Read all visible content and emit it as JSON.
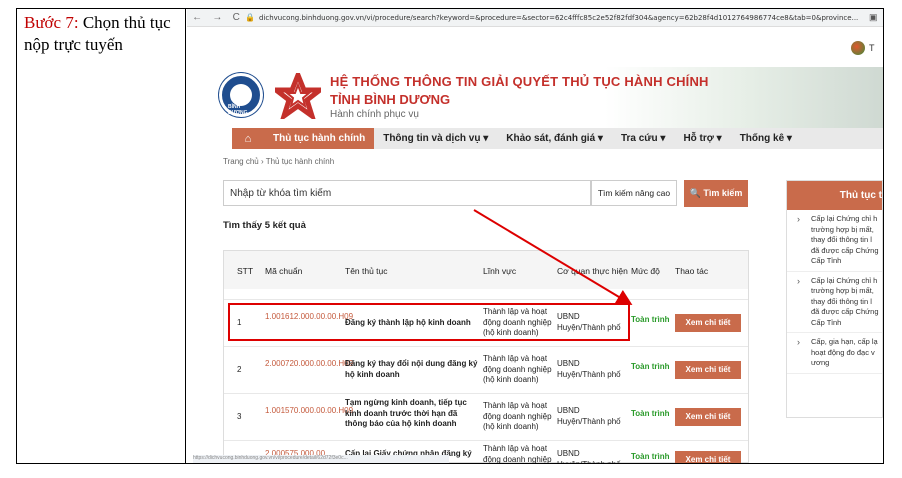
{
  "step": {
    "label": "Bước 7:",
    "text": "Chọn thủ tục nộp trực tuyến"
  },
  "browser": {
    "url": "dichvucong.binhduong.gov.vn/vi/procedure/search?keyword=&procedure=&sector=62c4fffc85c2e52f82fdf304&agency=62b28f4d1012764986774ce8&tab=0&province...",
    "back": "←",
    "forward": "→",
    "reload": "C"
  },
  "header": {
    "title_line1": "HỆ THỐNG THÔNG TIN GIẢI QUYẾT THỦ TỤC HÀNH CHÍNH",
    "title_line2": "TỈNH BÌNH DƯƠNG",
    "subtitle": "Hành chính phục vụ",
    "logo_label": "BÌNH DƯƠNG",
    "corner_text": "T"
  },
  "menu": {
    "items": [
      {
        "label": "Thủ tục hành chính"
      },
      {
        "label": "Thông tin và dịch vụ ▾"
      },
      {
        "label": "Khảo sát, đánh giá ▾"
      },
      {
        "label": "Tra cứu ▾"
      },
      {
        "label": "Hỗ trợ ▾"
      },
      {
        "label": "Thống kê ▾"
      }
    ]
  },
  "breadcrumb": "Trang chủ  ›  Thủ tục hành chính",
  "search": {
    "placeholder": "Nhập từ khóa tìm kiếm",
    "advanced": "Tìm kiếm nâng cao",
    "button": "🔍 Tìm kiếm"
  },
  "result_count": "Tìm thấy 5 kết quả",
  "table": {
    "headers": [
      "STT",
      "Mã chuẩn",
      "Tên thủ tục",
      "Lĩnh vực",
      "Cơ quan thực hiện",
      "Mức độ",
      "Thao tác"
    ],
    "rows": [
      {
        "stt": "1",
        "ma": "1.001612.000.00.00.H09",
        "ten": "Đăng ký thành lập hộ kinh doanh",
        "linhvuc": "Thành lập và hoạt động doanh nghiệp (hộ kinh doanh)",
        "coquan": "UBND Huyện/Thành phố",
        "mucdo": "Toàn trình",
        "thaotac": "Xem chi tiết"
      },
      {
        "stt": "2",
        "ma": "2.000720.000.00.00.H09",
        "ten": "Đăng ký thay đổi nội dung đăng ký hộ kinh doanh",
        "linhvuc": "Thành lập và hoạt động doanh nghiệp (hộ kinh doanh)",
        "coquan": "UBND Huyện/Thành phố",
        "mucdo": "Toàn trình",
        "thaotac": "Xem chi tiết"
      },
      {
        "stt": "3",
        "ma": "1.001570.000.00.00.H09",
        "ten": "Tạm ngừng kinh doanh, tiếp tục kinh doanh trước thời hạn đã thông báo của hộ kinh doanh",
        "linhvuc": "Thành lập và hoạt động doanh nghiệp (hộ kinh doanh)",
        "coquan": "UBND Huyện/Thành phố",
        "mucdo": "Toàn trình",
        "thaotac": "Xem chi tiết"
      },
      {
        "stt": "4",
        "ma": "2.000575.000.00.",
        "ten": "Cấp lại Giấy chứng nhận đăng ký hộ",
        "linhvuc": "Thành lập và hoạt động doanh nghiệp",
        "coquan": "UBND Huyện/Thành phố",
        "mucdo": "Toàn trình",
        "thaotac": "Xem chi tiết"
      }
    ]
  },
  "sidebar": {
    "title": "Thủ tục t",
    "items": [
      {
        "text": "Cấp lại Chứng chỉ h trường hợp bị mất, thay đổi thông tin l đã được cấp Chứng Cấp Tỉnh"
      },
      {
        "text": "Cấp lại Chứng chỉ h trường hợp bị mất, thay đổi thông tin l đã được cấp Chứng Cấp Tỉnh"
      },
      {
        "text": "Cấp, gia hạn, cấp lạ hoạt động đo đạc v ương"
      }
    ]
  },
  "statusbar": "https://dichvucong.binhduong.gov.vn/vi/procedure/detail/62d72f3e0c..."
}
